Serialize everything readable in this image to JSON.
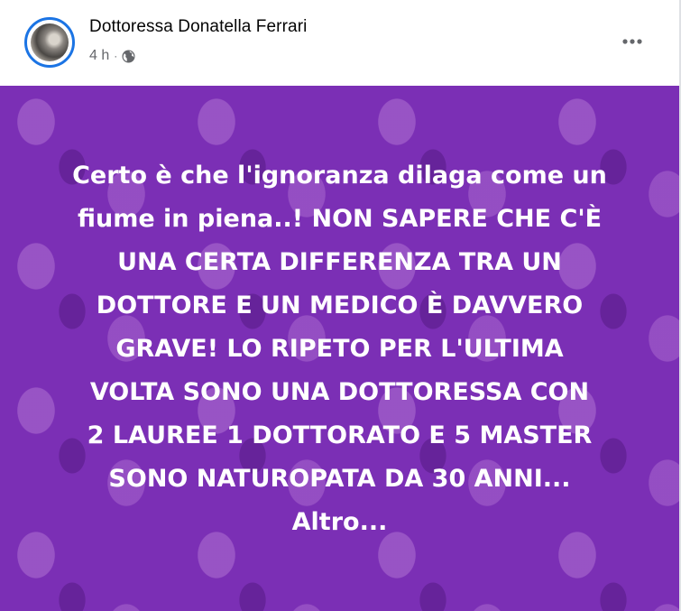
{
  "post": {
    "author": "Dottoressa Donatella Ferrari",
    "time": "4 h",
    "separator": "·",
    "privacy_icon": "globe-icon",
    "more_icon": "more-options-icon",
    "background_color": "#7b2fb5",
    "text_lines": [
      "Certo è che l'ignoranza dilaga come un",
      "fiume in piena..! NON SAPERE CHE C'È",
      "UNA CERTA DIFFERENZA TRA UN",
      "DOTTORE E UN MEDICO È DAVVERO",
      "GRAVE! LO RIPETO PER L'ULTIMA",
      "VOLTA SONO UNA DOTTORESSA CON",
      "2 LAUREE 1 DOTTORATO E 5 MASTER",
      "SONO NATUROPATA DA 30 ANNI..."
    ],
    "see_more": "Altro..."
  }
}
